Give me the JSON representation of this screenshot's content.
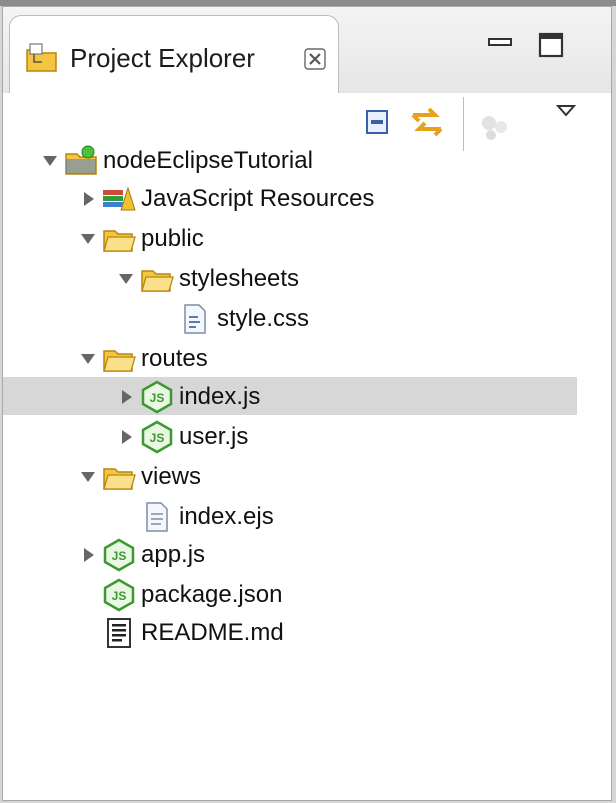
{
  "panel": {
    "tab_title": "Project Explorer"
  },
  "tree": [
    {
      "label": "nodeEclipseTutorial",
      "icon": "project-folder-icon",
      "twisty": "expanded"
    },
    {
      "label": "JavaScript Resources",
      "icon": "library-icon",
      "twisty": "collapsed"
    },
    {
      "label": "public",
      "icon": "folder-icon",
      "twisty": "expanded"
    },
    {
      "label": "stylesheets",
      "icon": "folder-icon",
      "twisty": "expanded"
    },
    {
      "label": "style.css",
      "icon": "css-file-icon",
      "twisty": "none"
    },
    {
      "label": "routes",
      "icon": "folder-icon",
      "twisty": "expanded"
    },
    {
      "label": "index.js",
      "icon": "js-file-icon",
      "twisty": "collapsed",
      "selected": true
    },
    {
      "label": "user.js",
      "icon": "js-file-icon",
      "twisty": "collapsed"
    },
    {
      "label": "views",
      "icon": "folder-icon",
      "twisty": "expanded"
    },
    {
      "label": "index.ejs",
      "icon": "text-file-icon",
      "twisty": "none"
    },
    {
      "label": "app.js",
      "icon": "js-file-icon",
      "twisty": "collapsed"
    },
    {
      "label": "package.json",
      "icon": "js-file-icon",
      "twisty": "none"
    },
    {
      "label": "README.md",
      "icon": "markdown-file-icon",
      "twisty": "none"
    }
  ],
  "colors": {
    "folder": "#f5c542",
    "js_green": "#3a9a2f",
    "selection": "#d7d7d7"
  }
}
